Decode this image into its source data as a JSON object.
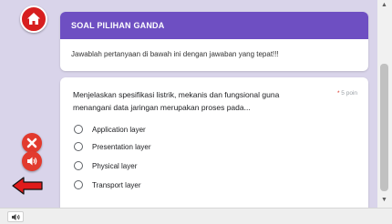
{
  "controls": {
    "home_icon": "home-icon",
    "close_icon": "close-icon",
    "sound_icon": "sound-icon",
    "back_icon": "arrow-left-icon",
    "mute_icon": "speaker-icon"
  },
  "colors": {
    "stage_background": "#d9d4ea",
    "header_bar": "#6e4fc2",
    "button_red": "#e23a2e",
    "required_star": "#d93025"
  },
  "header": {
    "title": "SOAL PILIHAN GANDA",
    "description": "Jawablah pertanyaan di bawah ini dengan jawaban yang tepat!!!"
  },
  "question": {
    "text": "Menjelaskan spesifikasi listrik, mekanis dan fungsional guna menangani data jaringan merupakan proses pada...",
    "required_mark": "*",
    "points": "5 poin",
    "options": [
      {
        "label": "Application layer"
      },
      {
        "label": "Presentation layer"
      },
      {
        "label": "Physical layer"
      },
      {
        "label": "Transport layer"
      }
    ]
  }
}
